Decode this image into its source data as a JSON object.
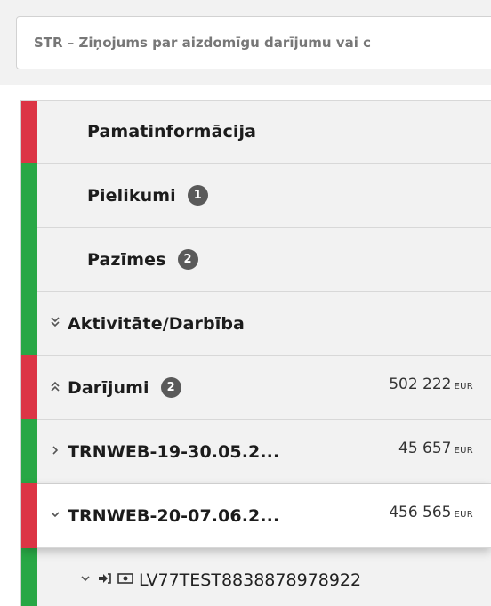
{
  "report": {
    "title": "STR – Ziņojums par aizdomīgu darījumu vai c"
  },
  "colors": {
    "red": "#dc3545",
    "green": "#28a745"
  },
  "nav": {
    "pamatinformacija": {
      "label": "Pamatinformācija",
      "status": "red"
    },
    "pielikumi": {
      "label": "Pielikumi",
      "badge": "1",
      "status": "green"
    },
    "pazimes": {
      "label": "Pazīmes",
      "badge": "2",
      "status": "green"
    },
    "aktivitate": {
      "label": "Aktivitāte/Darbība",
      "chevron": "«",
      "status": "green"
    },
    "darijumi": {
      "label": "Darījumi",
      "badge": "2",
      "chevron": "«",
      "amount": "502 222",
      "currency": "EUR",
      "status": "red"
    },
    "trn19": {
      "label": "TRNWEB-19-30.05.2...",
      "chevron": ">",
      "amount": "45 657",
      "currency": "EUR",
      "status": "green"
    },
    "trn20": {
      "label": "TRNWEB-20-07.06.2...",
      "chevron": "v",
      "amount": "456 565",
      "currency": "EUR",
      "status": "red"
    },
    "account": {
      "label": "LV77TEST8838878978922",
      "chevron": "v",
      "status": "green"
    }
  }
}
